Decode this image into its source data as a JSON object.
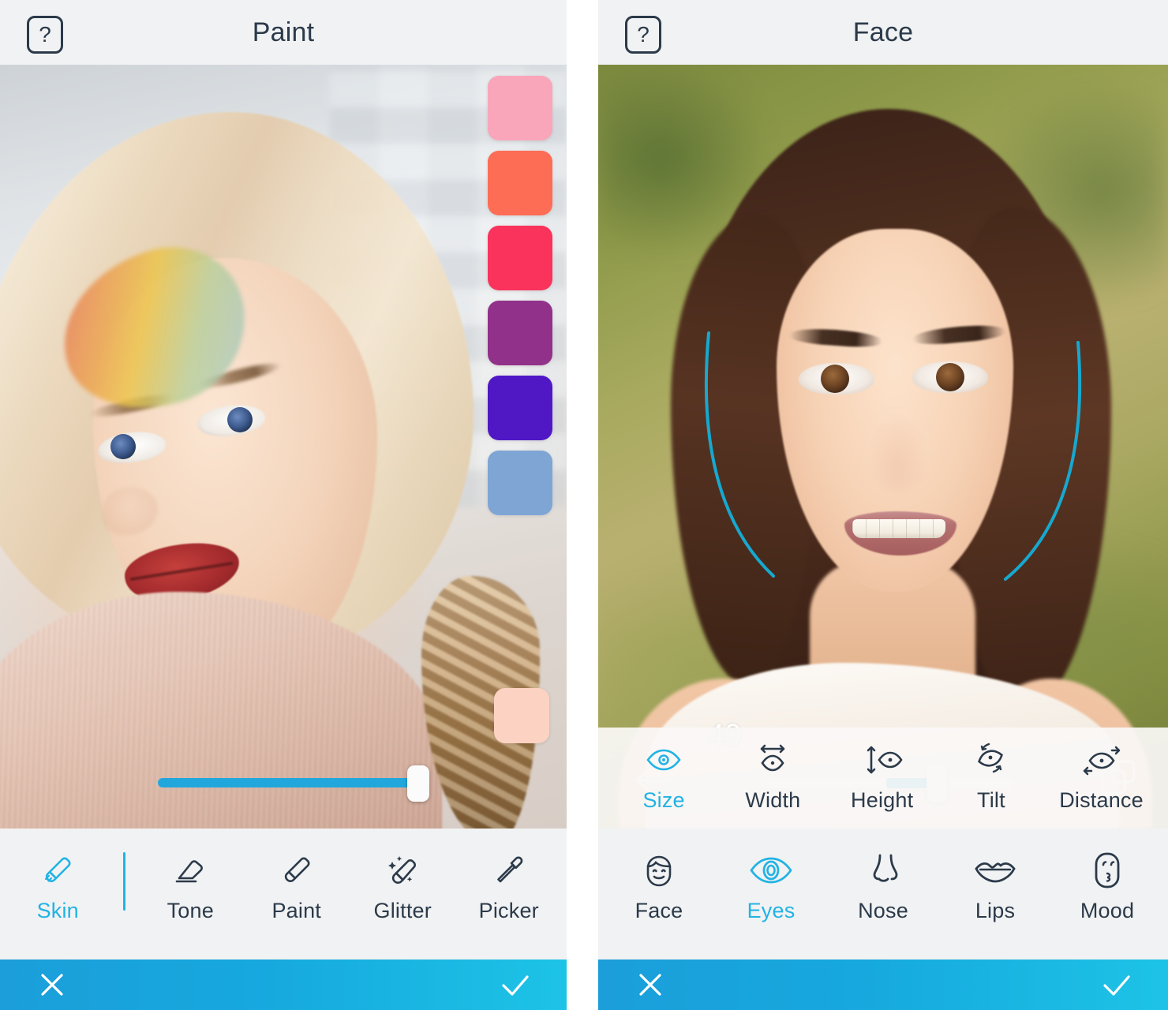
{
  "left_panel": {
    "header": {
      "title": "Paint",
      "help_label": "?"
    },
    "palette": {
      "colors": [
        "#F9A6BB",
        "#FD6C55",
        "#F9335C",
        "#92318A",
        "#5017C5",
        "#7FA5D4"
      ],
      "tone_color": "#FCD2C2"
    },
    "slider": {
      "value_percent": 100,
      "fill_color": "#22A7DD"
    },
    "tools": [
      {
        "label": "Skin",
        "icon": "skin-brush-icon",
        "active": true
      },
      {
        "label": "Tone",
        "icon": "eraser-icon",
        "active": false
      },
      {
        "label": "Paint",
        "icon": "paintbrush-icon",
        "active": false
      },
      {
        "label": "Glitter",
        "icon": "glitter-brush-icon",
        "active": false
      },
      {
        "label": "Picker",
        "icon": "eyedropper-icon",
        "active": false
      }
    ],
    "actions": {
      "cancel": "close-icon",
      "confirm": "check-icon"
    }
  },
  "right_panel": {
    "header": {
      "title": "Face",
      "help_label": "?"
    },
    "slider": {
      "value": "40",
      "min": -100,
      "max": 100,
      "fill_color": "#12A3D6",
      "fill_start_percent": 50,
      "fill_end_percent": 70
    },
    "undo_icon": "arrow-left-icon",
    "compare_icon": "compare-layers-icon",
    "guide_color": "#17A8CF",
    "sub_tools": [
      {
        "label": "Size",
        "icon": "eye-size-icon",
        "active": true
      },
      {
        "label": "Width",
        "icon": "eye-width-icon",
        "active": false
      },
      {
        "label": "Height",
        "icon": "eye-height-icon",
        "active": false
      },
      {
        "label": "Tilt",
        "icon": "eye-tilt-icon",
        "active": false
      },
      {
        "label": "Distance",
        "icon": "eye-distance-icon",
        "active": false
      }
    ],
    "main_tools": [
      {
        "label": "Face",
        "icon": "face-icon",
        "active": false
      },
      {
        "label": "Eyes",
        "icon": "eye-icon",
        "active": true
      },
      {
        "label": "Nose",
        "icon": "nose-icon",
        "active": false
      },
      {
        "label": "Lips",
        "icon": "lips-icon",
        "active": false
      },
      {
        "label": "Mood",
        "icon": "mood-icon",
        "active": false
      }
    ],
    "actions": {
      "cancel": "close-icon",
      "confirm": "check-icon"
    }
  },
  "theme": {
    "accent": "#22B3E4",
    "ink": "#2B3A4A",
    "toolbar_bg": "#F1F2F3",
    "action_gradient_from": "#1B9ED9",
    "action_gradient_to": "#1DC3E6"
  }
}
